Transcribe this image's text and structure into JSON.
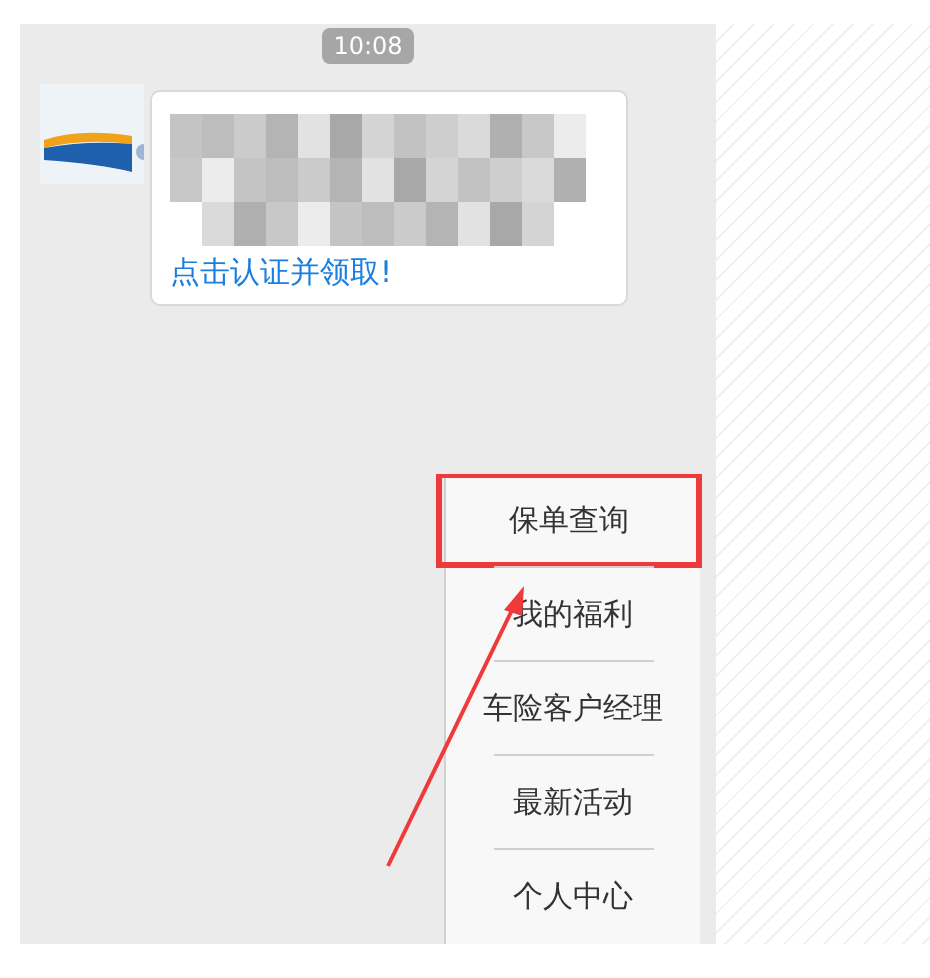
{
  "timestamp": "10:08",
  "message": {
    "link": "点击认证并领取!"
  },
  "menu": {
    "items": [
      {
        "label": "保单查询",
        "highlighted": true
      },
      {
        "label": "我的福利",
        "highlighted": false
      },
      {
        "label": "车险客户经理",
        "highlighted": false
      },
      {
        "label": "最新活动",
        "highlighted": false
      },
      {
        "label": "个人中心",
        "highlighted": false
      }
    ]
  }
}
